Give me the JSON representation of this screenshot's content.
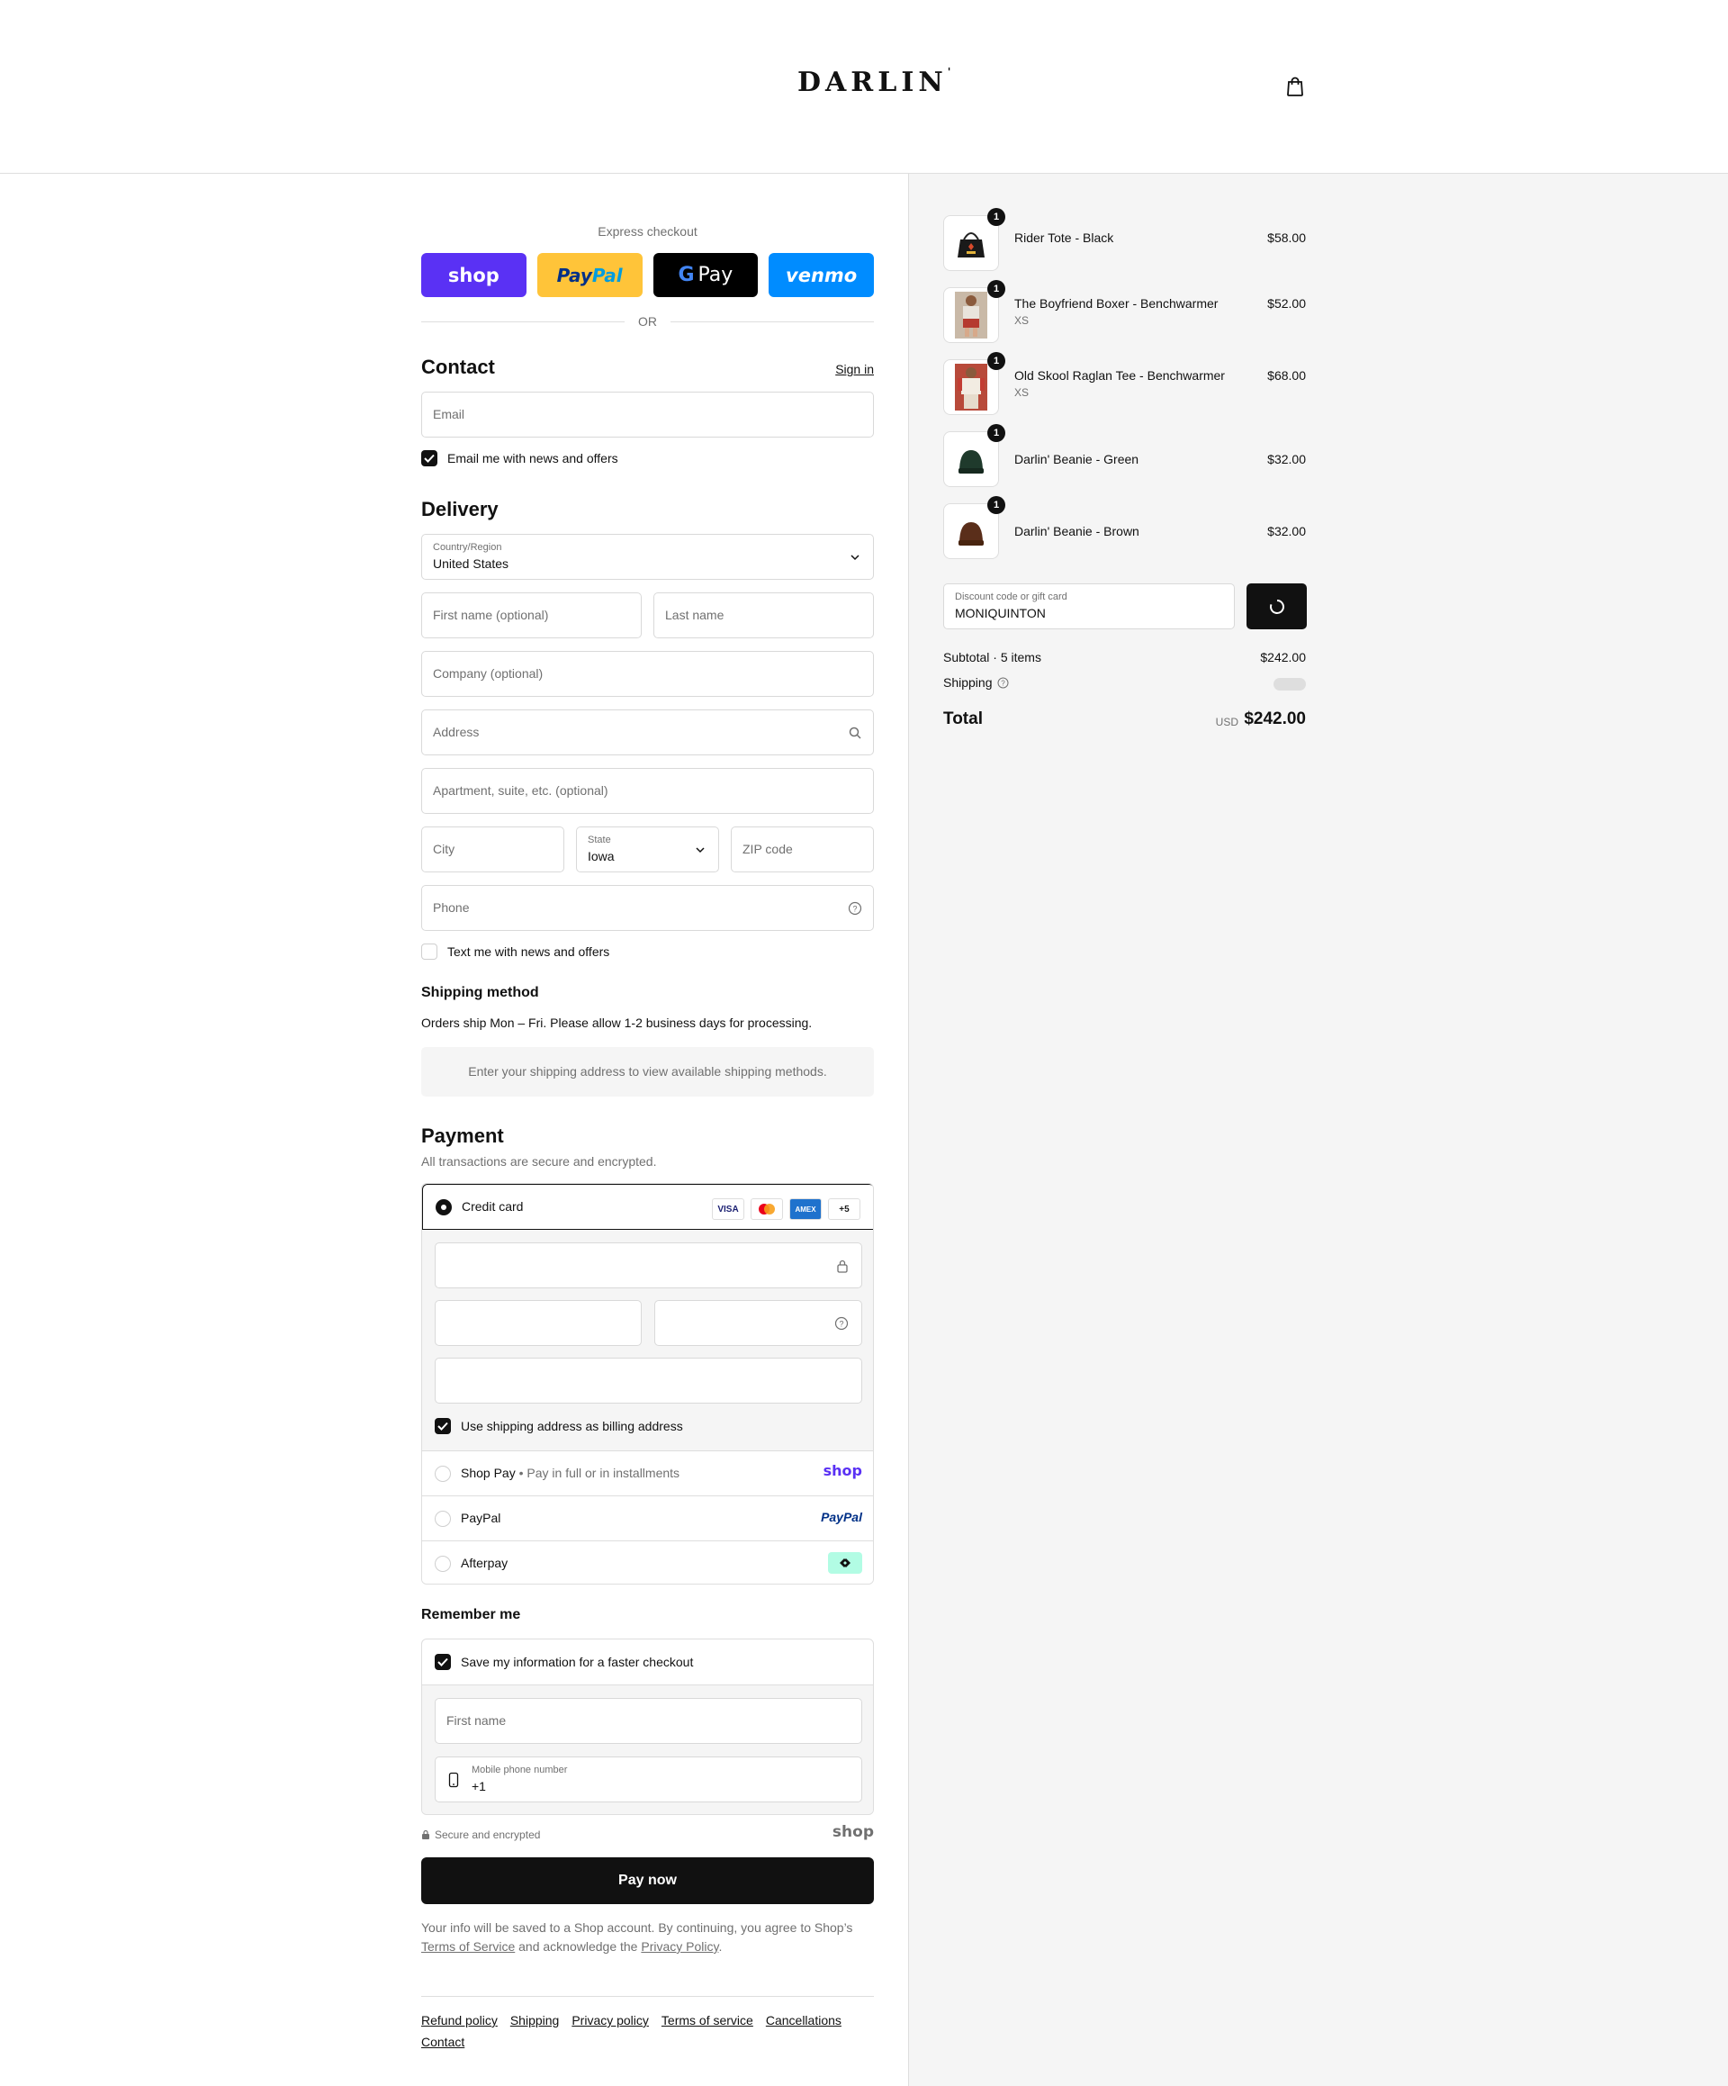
{
  "header": {
    "logo": "DARLIN",
    "logo_mark": "'"
  },
  "express": {
    "label": "Express checkout",
    "buttons": {
      "shop": "shop",
      "paypal_a": "Pay",
      "paypal_b": "Pal",
      "gpay": "Pay",
      "venmo": "venmo"
    },
    "or": "OR"
  },
  "contact": {
    "heading": "Contact",
    "sign_in": "Sign in",
    "email_placeholder": "Email",
    "newsletter_label": "Email me with news and offers"
  },
  "delivery": {
    "heading": "Delivery",
    "country_label": "Country/Region",
    "country_value": "United States",
    "first_name_placeholder": "First name (optional)",
    "last_name_placeholder": "Last name",
    "company_placeholder": "Company (optional)",
    "address_placeholder": "Address",
    "apartment_placeholder": "Apartment, suite, etc. (optional)",
    "city_placeholder": "City",
    "state_label": "State",
    "state_value": "Iowa",
    "zip_placeholder": "ZIP code",
    "phone_placeholder": "Phone",
    "sms_label": "Text me with news and offers"
  },
  "shipping_method": {
    "heading": "Shipping method",
    "info": "Orders ship Mon – Fri. Please allow 1-2 business days for processing.",
    "placeholder_box": "Enter your shipping address to view available shipping methods."
  },
  "payment": {
    "heading": "Payment",
    "subtitle": "All transactions are secure and encrypted.",
    "credit_card_label": "Credit card",
    "card_brands": [
      "VISA",
      "MC",
      "AMEX",
      "+5"
    ],
    "billing_same_label": "Use shipping address as billing address",
    "shop_pay_label": "Shop Pay",
    "shop_pay_sub": "Pay in full or in installments",
    "shop_pay_logo": "shop",
    "paypal_label": "PayPal",
    "paypal_logo": "PayPal",
    "afterpay_label": "Afterpay"
  },
  "remember": {
    "heading": "Remember me",
    "save_label": "Save my information for a faster checkout",
    "first_name_placeholder": "First name",
    "mobile_label": "Mobile phone number",
    "mobile_value": "+1",
    "secure_label": "Secure and encrypted",
    "shop_logo": "shop"
  },
  "pay_now": "Pay now",
  "legal": {
    "text_a": "Your info will be saved to a Shop account. By continuing, you agree to Shop’s",
    "terms": "Terms of Service",
    "text_b": "and acknowledge the",
    "privacy": "Privacy Policy",
    "text_c": "."
  },
  "footer": {
    "links": [
      "Refund policy",
      "Shipping",
      "Privacy policy",
      "Terms of service",
      "Cancellations",
      "Contact"
    ]
  },
  "cart": {
    "items": [
      {
        "name": "Rider Tote - Black",
        "variant": "",
        "price": "$58.00",
        "qty": "1"
      },
      {
        "name": "The Boyfriend Boxer - Benchwarmer",
        "variant": "XS",
        "price": "$52.00",
        "qty": "1"
      },
      {
        "name": "Old Skool Raglan Tee - Benchwarmer",
        "variant": "XS",
        "price": "$68.00",
        "qty": "1"
      },
      {
        "name": "Darlin' Beanie - Green",
        "variant": "",
        "price": "$32.00",
        "qty": "1"
      },
      {
        "name": "Darlin' Beanie - Brown",
        "variant": "",
        "price": "$32.00",
        "qty": "1"
      }
    ],
    "discount_label": "Discount code or gift card",
    "discount_value": "MONIQUINTON",
    "subtotal_label": "Subtotal · 5 items",
    "subtotal_value": "$242.00",
    "shipping_label": "Shipping",
    "total_label": "Total",
    "currency": "USD",
    "total_value": "$242.00"
  },
  "colors": {
    "shop_purple": "#5a31f4",
    "paypal_yellow": "#ffc439",
    "venmo_blue": "#008cff",
    "afterpay_mint": "#b2fce4",
    "text_dark": "#111111",
    "muted": "#707070"
  }
}
